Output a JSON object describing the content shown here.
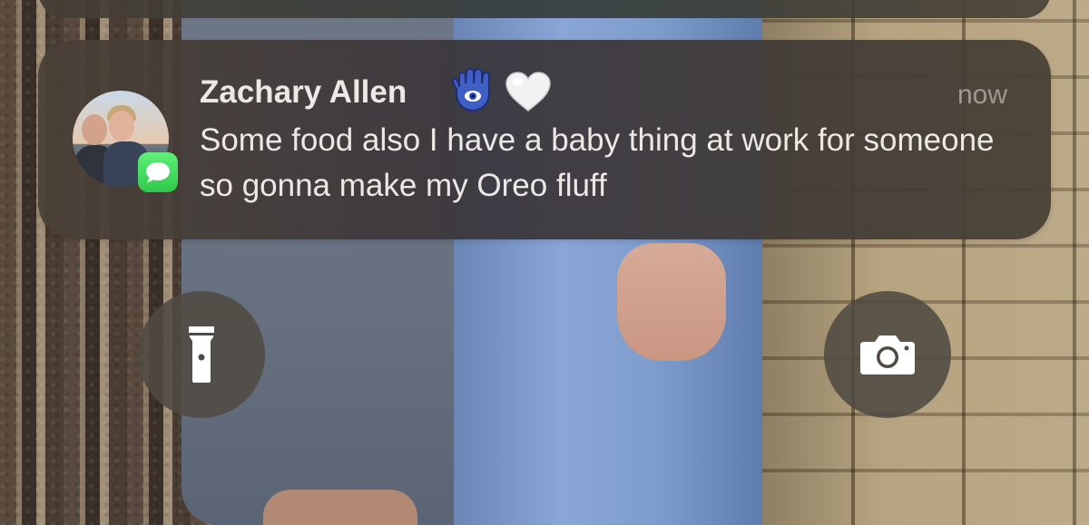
{
  "notification": {
    "sender": "Zachary Allen",
    "sender_emojis": [
      "hamsa-icon",
      "white-heart-icon"
    ],
    "time": "now",
    "message": "Some food also I have a baby thing at work for someone so gonna make my Oreo fluff",
    "app_icon": "messages-icon"
  },
  "controls": {
    "left": "flashlight-icon",
    "right": "camera-icon"
  },
  "colors": {
    "messages_green": "#34C759",
    "text": "#ECE9E4",
    "time_text": "#9E9A92"
  }
}
